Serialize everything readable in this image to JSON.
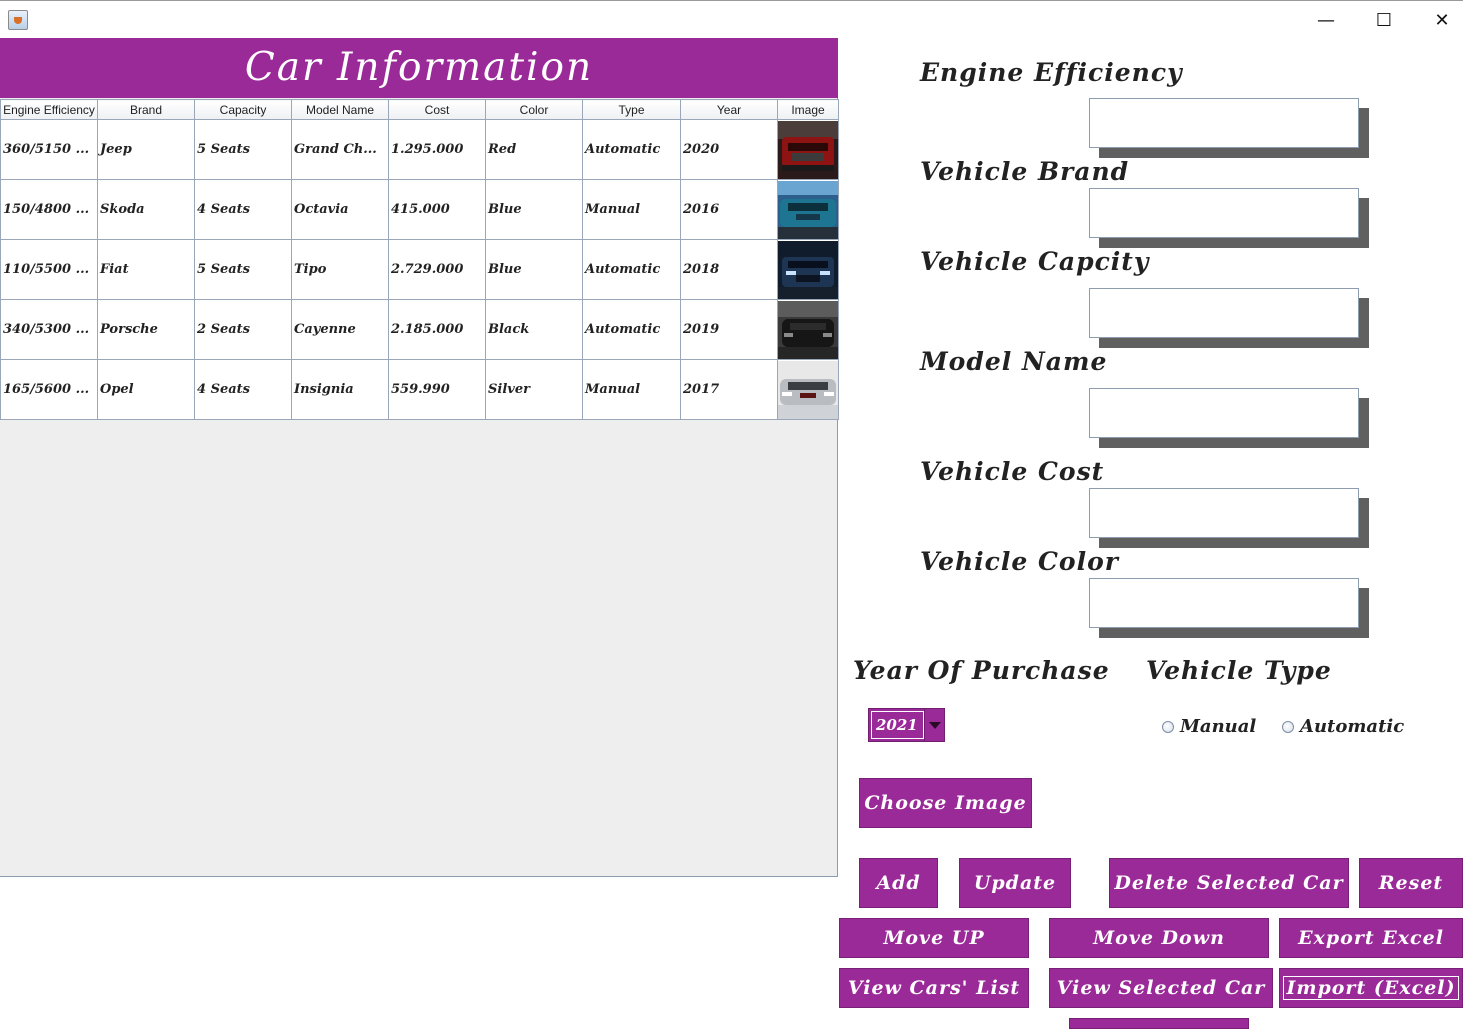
{
  "window": {
    "minimize_glyph": "—",
    "maximize_glyph": "☐",
    "close_glyph": "✕"
  },
  "table": {
    "title": "Car Information",
    "columns": [
      "Engine Efficiency",
      "Brand",
      "Capacity",
      "Model Name",
      "Cost",
      "Color",
      "Type",
      "Year",
      "Image"
    ],
    "rows": [
      {
        "efficiency": "360/5150 ...",
        "brand": "Jeep",
        "capacity": "5 Seats",
        "model": "Grand Ch...",
        "cost": "1.295.000",
        "color": "Red",
        "type": "Automatic",
        "year": "2020",
        "image": "red-jeep-thumbnail"
      },
      {
        "efficiency": "150/4800 ...",
        "brand": "Skoda",
        "capacity": "4 Seats",
        "model": "Octavia",
        "cost": "415.000",
        "color": "Blue",
        "type": "Manual",
        "year": "2016",
        "image": "blue-skoda-thumbnail"
      },
      {
        "efficiency": "110/5500 ...",
        "brand": "Fiat",
        "capacity": "5 Seats",
        "model": "Tipo",
        "cost": "2.729.000",
        "color": "Blue",
        "type": "Automatic",
        "year": "2018",
        "image": "blue-fiat-thumbnail"
      },
      {
        "efficiency": "340/5300 ...",
        "brand": "Porsche",
        "capacity": "2 Seats",
        "model": "Cayenne",
        "cost": "2.185.000",
        "color": "Black",
        "type": "Automatic",
        "year": "2019",
        "image": "black-porsche-thumbnail"
      },
      {
        "efficiency": "165/5600 ...",
        "brand": "Opel",
        "capacity": "4 Seats",
        "model": "Insignia",
        "cost": "559.990",
        "color": "Silver",
        "type": "Manual",
        "year": "2017",
        "image": "silver-opel-thumbnail"
      }
    ]
  },
  "form": {
    "engine_label": "Engine Efficiency",
    "engine_value": "",
    "brand_label": "Vehicle Brand",
    "brand_value": "",
    "capacity_label": "Vehicle Capcity",
    "capacity_value": "",
    "model_label": "Model Name",
    "model_value": "",
    "cost_label": "Vehicle Cost",
    "cost_value": "",
    "color_label": "Vehicle Color",
    "color_value": "",
    "year_label": "Year Of Purchase",
    "year_value": "2021",
    "type_label": "Vehicle Type",
    "type_manual": "Manual",
    "type_automatic": "Automatic"
  },
  "buttons": {
    "choose_image": "Choose Image",
    "add": "Add",
    "update": "Update",
    "delete_selected": "Delete Selected Car",
    "reset": "Reset",
    "move_up": "Move UP",
    "move_down": "Move Down",
    "export_excel": "Export Excel",
    "view_list": "View Cars' List",
    "view_selected": "View Selected Car",
    "import_excel": "Import (Excel)"
  },
  "colors": {
    "accent": "#9b2a99",
    "panel_bg": "#eeeeee",
    "field_shadow": "#606060"
  }
}
